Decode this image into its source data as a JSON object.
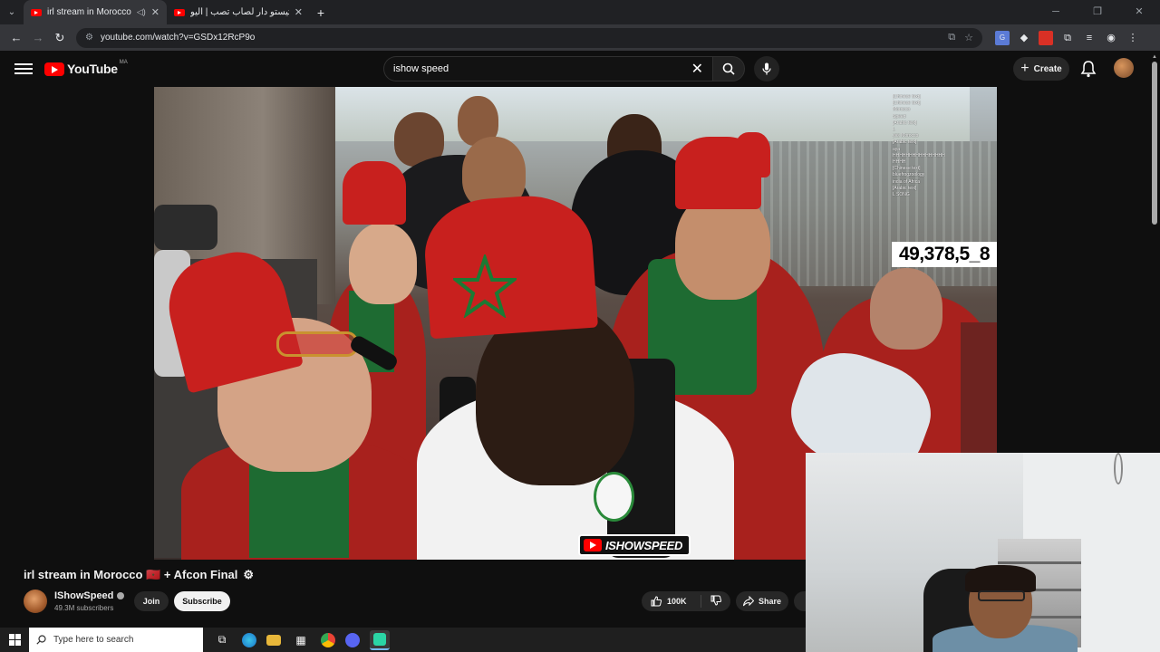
{
  "browser": {
    "tabs": [
      {
        "title": "irl stream in Morocco 🇲🇦 -",
        "active": true
      },
      {
        "title": "عمر تيستو دار لصاب تصب | اليو",
        "active": false
      }
    ],
    "new_tab": "+",
    "url": "youtube.com/watch?v=GSDx12RcP9o"
  },
  "youtube": {
    "logo_text": "YouTube",
    "country_code": "MA",
    "search_query": "ishow speed",
    "create_label": "Create"
  },
  "player": {
    "viewer_count": "49,378,5_8",
    "brand_tag": "ISHOWSPEED",
    "chat_lines": [
      "[Chinese text]",
      "[Chinese text]",
      "Morocco",
      "Speed",
      "[Arabic text]",
      "L",
      "yes Morocco",
      "[Arabic text]",
      "aya",
      "HHHHHHHHHHHHHHHH",
      "HHHH",
      "[Chinese text]",
      "bluefrogzoology",
      "india of Africa",
      "[Arabic text]",
      "L SONG"
    ]
  },
  "video": {
    "title": "irl stream in Morocco 🇲🇦 + Afcon Final",
    "channel_name": "IShowSpeed",
    "subscribers": "49.3M subscribers",
    "join_label": "Join",
    "subscribe_label": "Subscribe",
    "like_count": "100K",
    "share_label": "Share"
  },
  "taskbar": {
    "search_placeholder": "Type here to search"
  },
  "colors": {
    "yt_red": "#ff0000",
    "background": "#0f0f0f",
    "fez_red": "#c8201e",
    "morocco_green": "#1e6b32"
  }
}
